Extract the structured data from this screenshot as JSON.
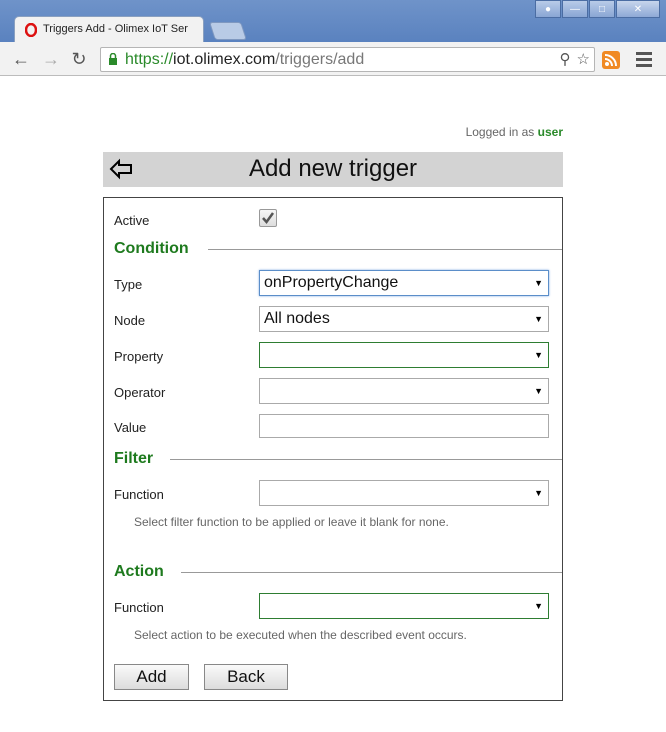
{
  "browser": {
    "tab_title": "Triggers Add - Olimex IoT Ser",
    "url_scheme": "https://",
    "url_host": "iot.olimex.com",
    "url_path": "/triggers/add"
  },
  "session": {
    "logged_in_prefix": "Logged in as",
    "username": "user"
  },
  "header": {
    "title": "Add new trigger"
  },
  "form": {
    "active_label": "Active",
    "active_checked": true,
    "condition_heading": "Condition",
    "type_label": "Type",
    "type_value": "onPropertyChange",
    "node_label": "Node",
    "node_value": "All nodes",
    "property_label": "Property",
    "property_value": "",
    "operator_label": "Operator",
    "operator_value": "",
    "value_label": "Value",
    "value_value": "",
    "filter_heading": "Filter",
    "filter_function_label": "Function",
    "filter_function_value": "",
    "filter_help": "Select filter function to be applied or leave it blank for none.",
    "action_heading": "Action",
    "action_function_label": "Function",
    "action_function_value": "",
    "action_help": "Select action to be executed when the described event occurs.",
    "add_label": "Add",
    "back_label": "Back"
  },
  "colors": {
    "accent_green": "#1e7a1e",
    "header_gray": "#d3d3d3"
  }
}
